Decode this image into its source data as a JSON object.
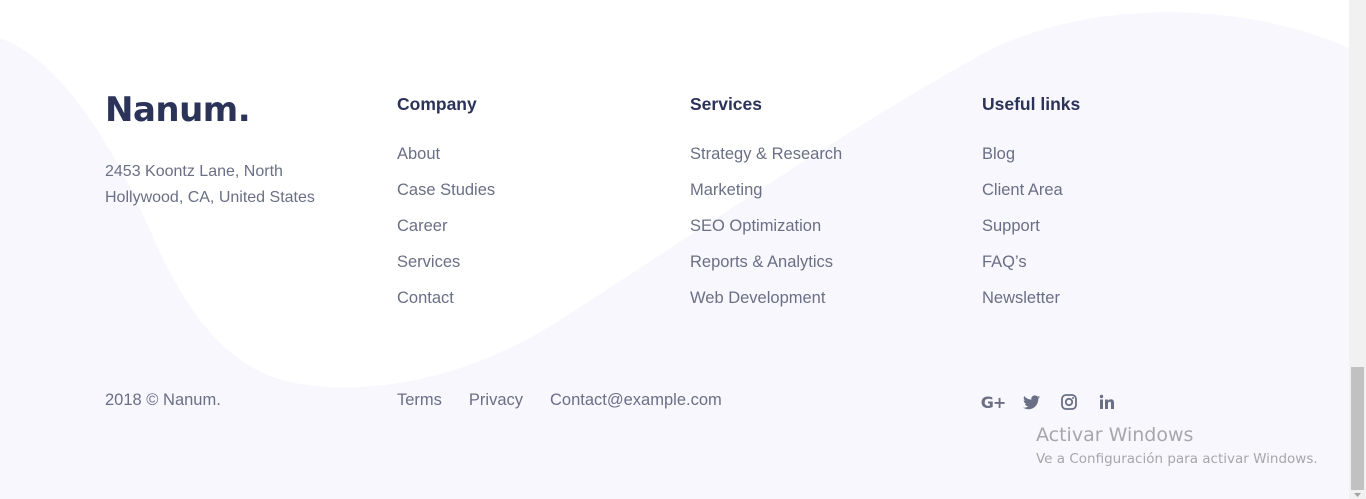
{
  "brand": {
    "logo": "Nanum.",
    "address": "2453 Koontz Lane, North Hollywood, CA, United States"
  },
  "columns": [
    {
      "title": "Company",
      "links": [
        "About",
        "Case Studies",
        "Career",
        "Services",
        "Contact"
      ]
    },
    {
      "title": "Services",
      "links": [
        "Strategy & Research",
        "Marketing",
        "SEO Optimization",
        "Reports & Analytics",
        "Web Development"
      ]
    },
    {
      "title": "Useful links",
      "links": [
        "Blog",
        "Client Area",
        "Support",
        "FAQ’s",
        "Newsletter"
      ]
    }
  ],
  "bottom": {
    "copyright": "2018 © Nanum.",
    "links": [
      "Terms",
      "Privacy",
      "Contact@example.com"
    ]
  },
  "social": {
    "gplus_text": "G+",
    "icons": [
      "google-plus-icon",
      "twitter-icon",
      "instagram-icon",
      "linkedin-icon"
    ]
  },
  "watermark": {
    "title": "Activar Windows",
    "subtitle": "Ve a Configuración para activar Windows."
  },
  "colors": {
    "background": "#f8f7fd",
    "wave": "#ffffff",
    "heading": "#2b3358",
    "text": "#6b6f85",
    "watermark": "#a6a7ad"
  }
}
